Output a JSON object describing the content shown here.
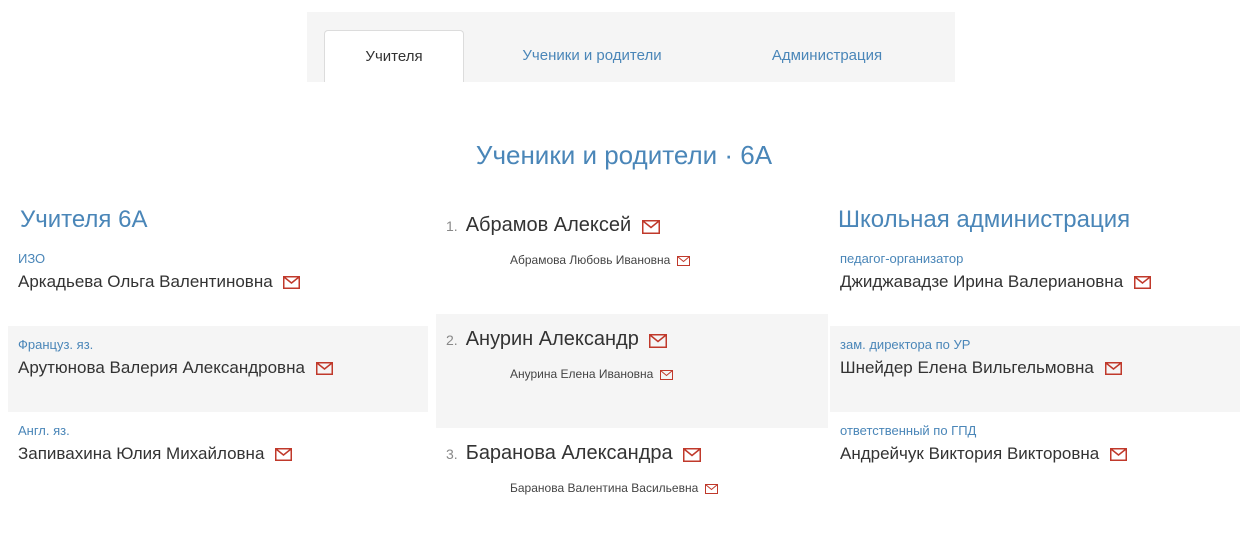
{
  "tabs": [
    {
      "label": "Учителя",
      "active": true
    },
    {
      "label": "Ученики и родители",
      "active": false
    },
    {
      "label": "Администрация",
      "active": false
    }
  ],
  "page_title": "Ученики и родители · 6А",
  "teachers": {
    "title": "Учителя 6А",
    "items": [
      {
        "role": "ИЗО",
        "name": "Аркадьева Ольга Валентиновна"
      },
      {
        "role": "Француз. яз.",
        "name": "Арутюнова Валерия Александровна"
      },
      {
        "role": "Англ. яз.",
        "name": "Запивахина Юлия Михайловна"
      }
    ]
  },
  "students": {
    "items": [
      {
        "number": "1.",
        "name": "Абрамов Алексей",
        "parent": "Абрамова Любовь Ивановна"
      },
      {
        "number": "2.",
        "name": "Анурин Александр",
        "parent": "Анурина Елена Ивановна"
      },
      {
        "number": "3.",
        "name": "Баранова Александра",
        "parent": "Баранова Валентина Васильевна"
      }
    ]
  },
  "administration": {
    "title": "Школьная администрация",
    "items": [
      {
        "role": "педагог-организатор",
        "name": "Джиджавадзе Ирина Валериановна"
      },
      {
        "role": "зам. директора по УР",
        "name": "Шнейдер Елена Вильгельмовна"
      },
      {
        "role": "ответственный по ГПД",
        "name": "Андрейчук Виктория Викторовна"
      }
    ]
  },
  "icons": {
    "mail": "envelope-icon"
  },
  "colors": {
    "accent": "#4a86b8",
    "mail_icon": "#c0392b",
    "shade": "#f5f5f5"
  }
}
